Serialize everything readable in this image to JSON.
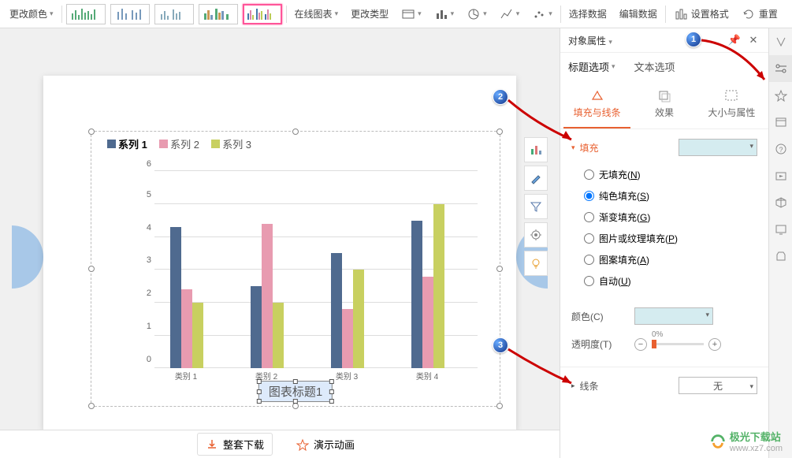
{
  "toolbar": {
    "change_color": "更改颜色",
    "online_chart": "在线图表",
    "change_type": "更改类型",
    "select_data": "选择数据",
    "edit_data": "编辑数据",
    "set_format": "设置格式",
    "reset": "重置"
  },
  "panel": {
    "title": "对象属性",
    "tab_title_opts": "标题选项",
    "tab_text_opts": "文本选项",
    "sub_fill_line": "填充与线条",
    "sub_effect": "效果",
    "sub_size_prop": "大小与属性",
    "sect_fill": "填充",
    "fill_none": "无填充(N)",
    "fill_solid": "纯色填充(S)",
    "fill_gradient": "渐变填充(G)",
    "fill_picture": "图片或纹理填充(P)",
    "fill_pattern": "图案填充(A)",
    "fill_auto": "自动(U)",
    "color_label": "颜色(C)",
    "transparency_label": "透明度(T)",
    "transparency_value": "0%",
    "sect_line": "线条",
    "line_none": "无"
  },
  "chart": {
    "legend_s1": "系列 1",
    "legend_s2": "系列 2",
    "legend_s3": "系列 3",
    "cat1": "类别 1",
    "cat2": "类别 2",
    "cat3": "类别 3",
    "cat4": "类别 4",
    "title_placeholder": "图表标题1",
    "y0": "0",
    "y1": "1",
    "y2": "2",
    "y3": "3",
    "y4": "4",
    "y5": "5",
    "y6": "6"
  },
  "chart_data": {
    "type": "bar",
    "categories": [
      "类别 1",
      "类别 2",
      "类别 3",
      "类别 4"
    ],
    "series": [
      {
        "name": "系列 1",
        "color": "#4f6a8f",
        "values": [
          4.3,
          2.5,
          3.5,
          4.5
        ]
      },
      {
        "name": "系列 2",
        "color": "#e89bb0",
        "values": [
          2.4,
          4.4,
          1.8,
          2.8
        ]
      },
      {
        "name": "系列 3",
        "color": "#c8d060",
        "values": [
          2.0,
          2.0,
          3.0,
          5.0
        ]
      }
    ],
    "ylim": [
      0,
      6
    ],
    "title": "图表标题1"
  },
  "footer": {
    "full_download": "整套下载",
    "present_anim": "演示动画"
  },
  "badges": {
    "b1": "1",
    "b2": "2",
    "b3": "3"
  },
  "watermark": {
    "name": "极光下载站",
    "url": "www.xz7.com"
  }
}
